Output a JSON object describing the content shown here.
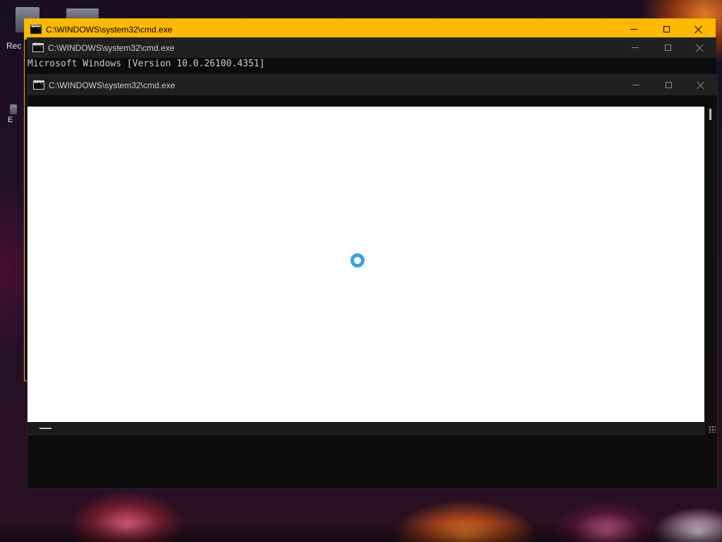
{
  "desktop": {
    "label_recycle_fragment": "Rec",
    "label_fragment_2": "E"
  },
  "windows": [
    {
      "title": "C:\\WINDOWS\\system32\\cmd.exe",
      "state": "active",
      "accent": "#ffb900"
    },
    {
      "title": "C:\\WINDOWS\\system32\\cmd.exe",
      "state": "inactive",
      "console_lines": [
        "Microsoft Windows [Version 10.0.26100.4351]"
      ]
    },
    {
      "title": "C:\\WINDOWS\\system32\\cmd.exe",
      "state": "inactive",
      "content": "loading-spinner",
      "spinner_color": "#3aa0e0"
    }
  ],
  "icons": {
    "app": "cmd-icon",
    "minimize": "minimize-icon",
    "maximize": "maximize-icon",
    "close": "close-icon"
  }
}
